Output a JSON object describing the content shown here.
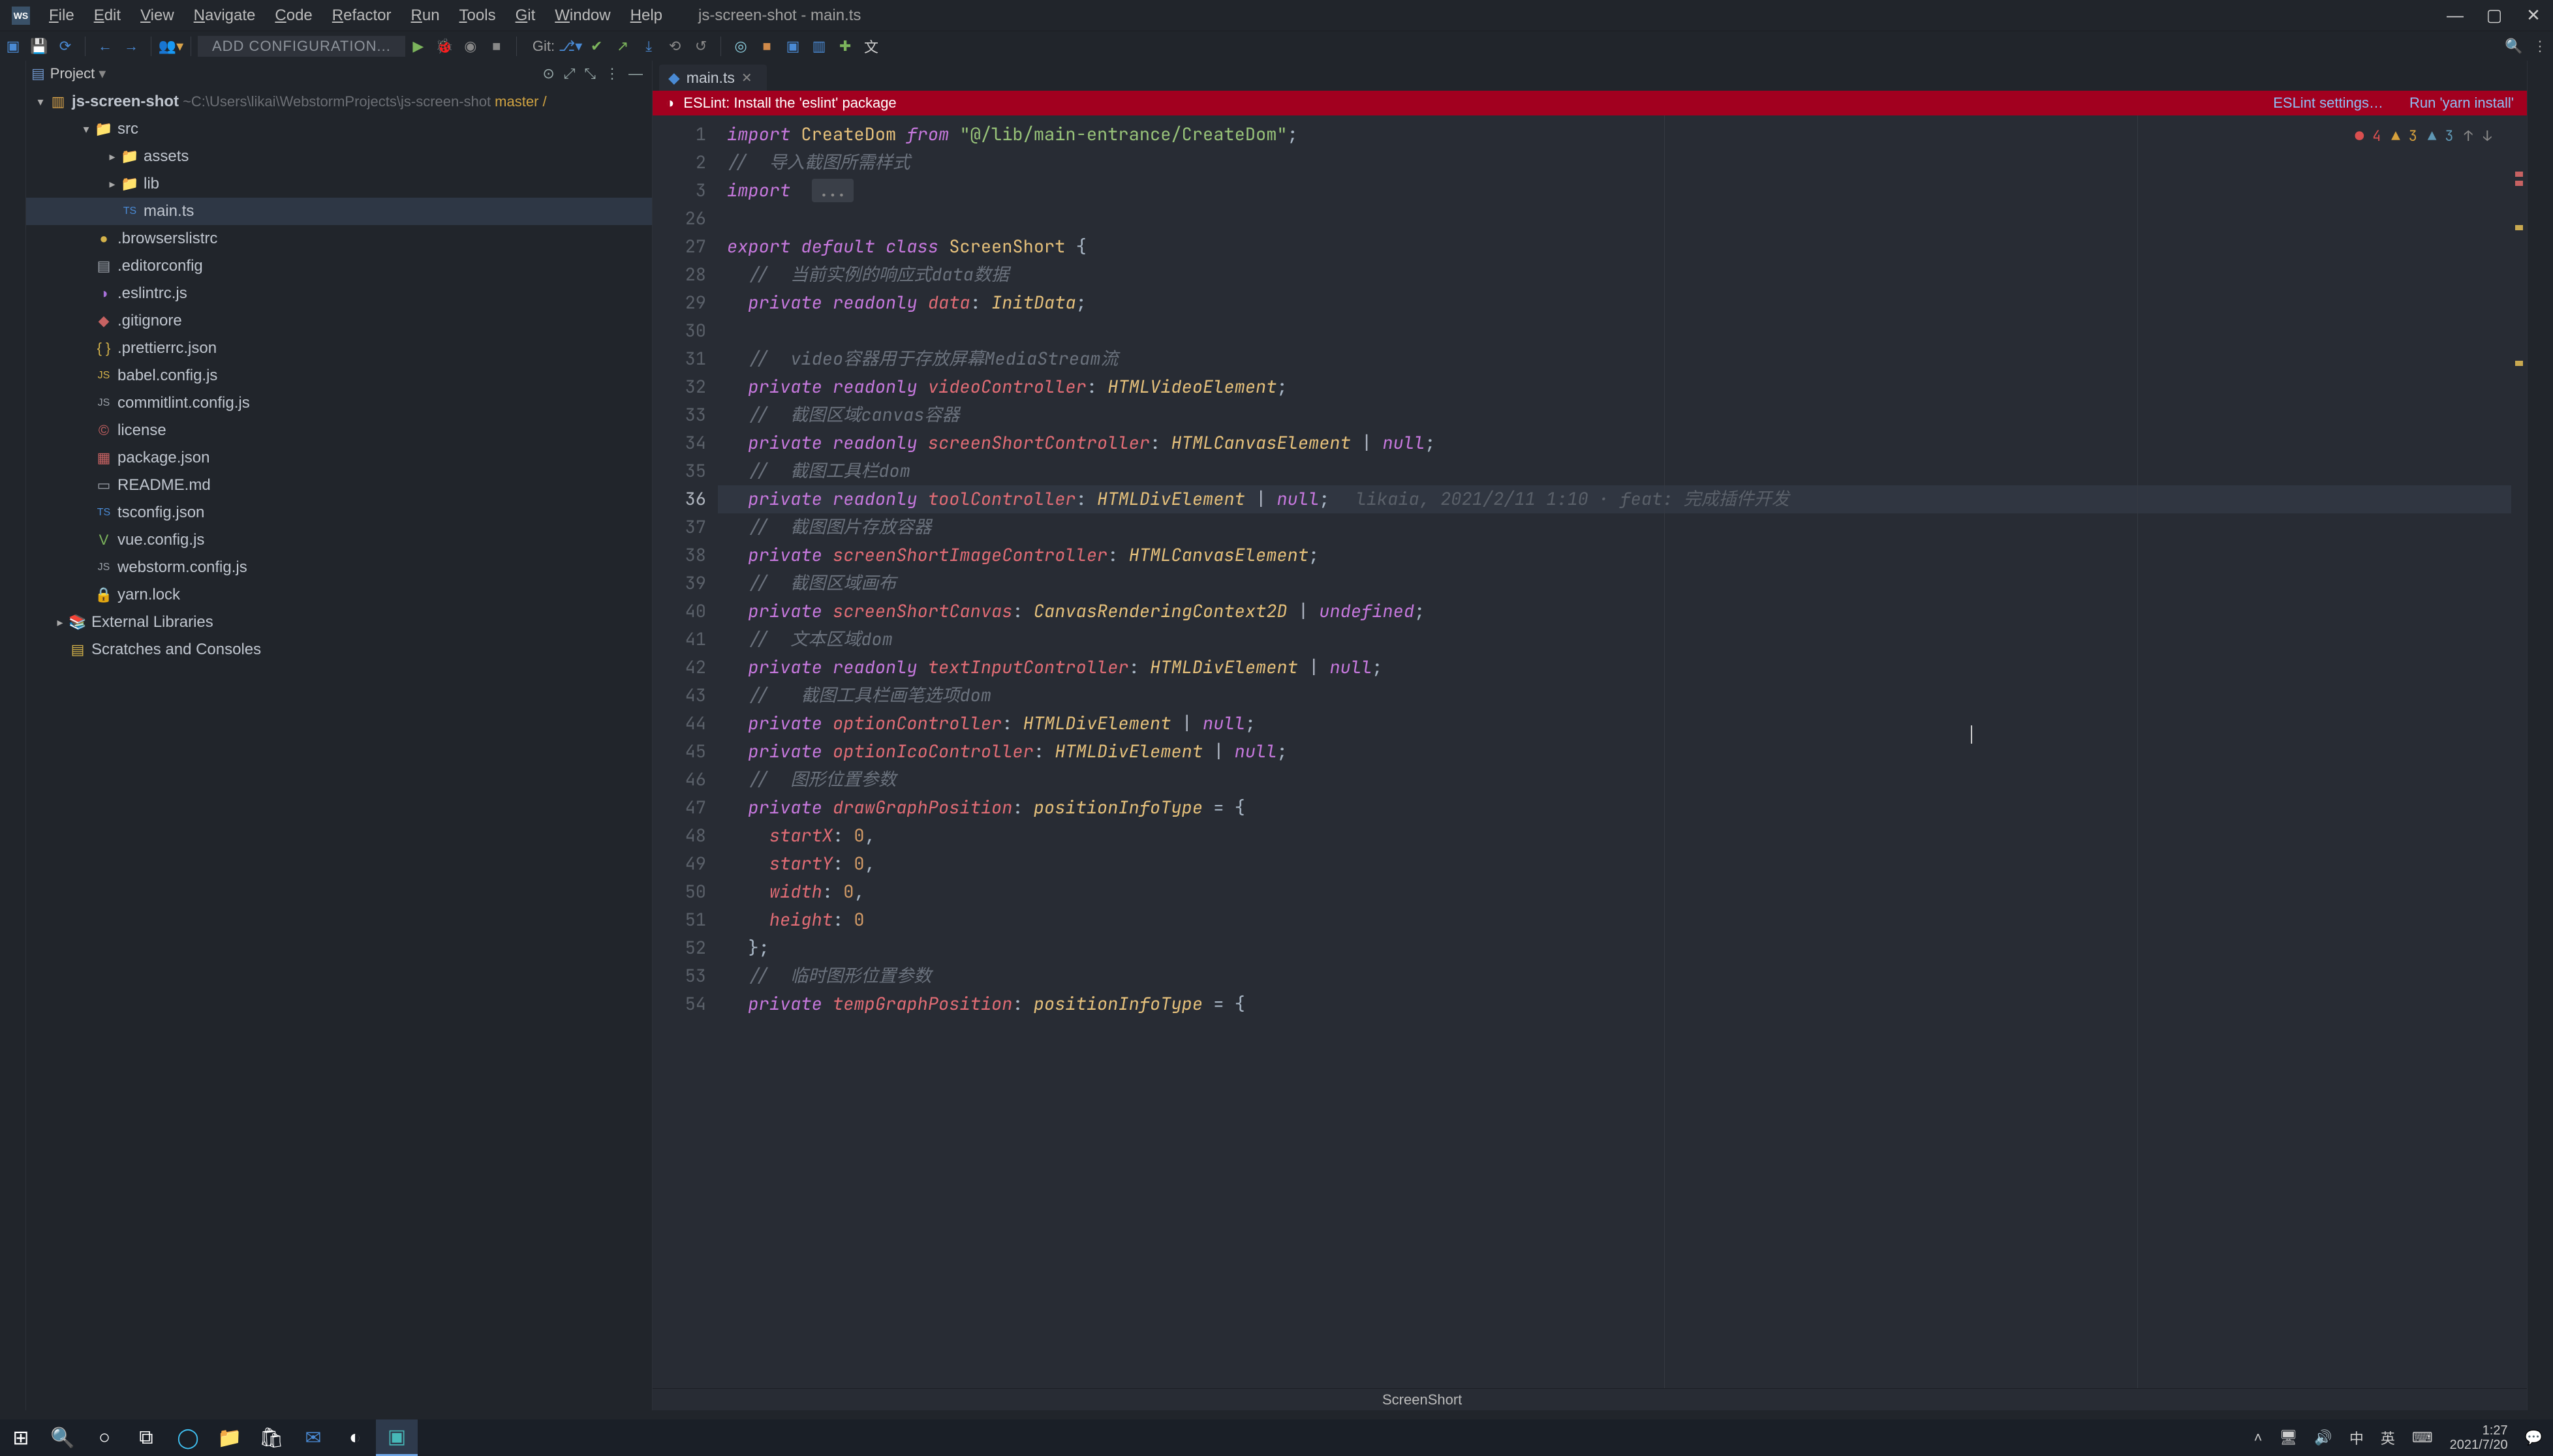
{
  "title_bar": {
    "app_logo": "WS",
    "menus": [
      "File",
      "Edit",
      "View",
      "Navigate",
      "Code",
      "Refactor",
      "Run",
      "Tools",
      "Git",
      "Window",
      "Help"
    ],
    "project_title": "js-screen-shot - main.ts"
  },
  "toolbar": {
    "add_config": "ADD CONFIGURATION...",
    "git_label": "Git:"
  },
  "project_panel": {
    "title": "Project",
    "root": {
      "name": "js-screen-shot",
      "path": "~C:\\Users\\likai\\WebstormProjects\\js-screen-shot",
      "branch": "master /"
    },
    "tree": [
      {
        "indent": 1,
        "caret": "▾",
        "icon": "folder",
        "color": "ic-folder",
        "label": "src"
      },
      {
        "indent": 2,
        "caret": "▸",
        "icon": "folder",
        "color": "ic-folder",
        "label": "assets"
      },
      {
        "indent": 2,
        "caret": "▸",
        "icon": "folder",
        "color": "ic-folder",
        "label": "lib"
      },
      {
        "indent": 2,
        "caret": "",
        "icon": "ts",
        "color": "ic-blue",
        "label": "main.ts",
        "selected": true
      },
      {
        "indent": 1,
        "caret": "",
        "icon": "dot",
        "color": "ic-yellow",
        "label": ".browserslistrc"
      },
      {
        "indent": 1,
        "caret": "",
        "icon": "cfg",
        "color": "ic-grey",
        "label": ".editorconfig"
      },
      {
        "indent": 1,
        "caret": "",
        "icon": "eslint",
        "color": "ic-purple",
        "label": ".eslintrc.js"
      },
      {
        "indent": 1,
        "caret": "",
        "icon": "git",
        "color": "ic-red",
        "label": ".gitignore"
      },
      {
        "indent": 1,
        "caret": "",
        "icon": "json",
        "color": "ic-yellow",
        "label": ".prettierrc.json"
      },
      {
        "indent": 1,
        "caret": "",
        "icon": "js",
        "color": "ic-yellow",
        "label": "babel.config.js"
      },
      {
        "indent": 1,
        "caret": "",
        "icon": "js",
        "color": "ic-grey",
        "label": "commitlint.config.js"
      },
      {
        "indent": 1,
        "caret": "",
        "icon": "lic",
        "color": "ic-red",
        "label": "license"
      },
      {
        "indent": 1,
        "caret": "",
        "icon": "npm",
        "color": "ic-red",
        "label": "package.json"
      },
      {
        "indent": 1,
        "caret": "",
        "icon": "md",
        "color": "ic-grey",
        "label": "README.md"
      },
      {
        "indent": 1,
        "caret": "",
        "icon": "ts",
        "color": "ic-blue",
        "label": "tsconfig.json"
      },
      {
        "indent": 1,
        "caret": "",
        "icon": "vue",
        "color": "ic-green",
        "label": "vue.config.js"
      },
      {
        "indent": 1,
        "caret": "",
        "icon": "js",
        "color": "ic-grey",
        "label": "webstorm.config.js"
      },
      {
        "indent": 1,
        "caret": "",
        "icon": "lock",
        "color": "ic-red",
        "label": "yarn.lock"
      },
      {
        "indent": 0,
        "caret": "▸",
        "icon": "lib",
        "color": "ic-yellow",
        "label": "External Libraries"
      },
      {
        "indent": 0,
        "caret": "",
        "icon": "scratch",
        "color": "ic-yellow",
        "label": "Scratches and Consoles"
      }
    ]
  },
  "editor": {
    "tab_label": "main.ts",
    "notice": {
      "text": "ESLint: Install the 'eslint' package",
      "link_settings": "ESLint settings…",
      "link_run": "Run 'yarn install'"
    },
    "inspections": {
      "errors": "4",
      "warnings": "3",
      "weak": "3"
    },
    "blame_text": "likaia, 2021/2/11 1:10 · feat: 完成插件开发",
    "breadcrumb": "ScreenShort",
    "lines": [
      {
        "n": "1",
        "html": "<span class='tok-kw'>import</span> <span class='tok-cls'>CreateDom</span> <span class='tok-kw'>from</span> <span class='tok-str'>\"@/lib/main-entrance/CreateDom\"</span>;"
      },
      {
        "n": "2",
        "html": "<span class='tok-cmt'>//  导入截图所需样式</span>"
      },
      {
        "n": "3",
        "html": "<span class='tok-kw'>import</span>  <span class='fold-dots'>...</span>"
      },
      {
        "n": "26",
        "html": ""
      },
      {
        "n": "27",
        "html": "<span class='tok-kw'>export</span> <span class='tok-kw'>default</span> <span class='tok-kw'>class</span> <span class='tok-cls'>ScreenShort</span> {"
      },
      {
        "n": "28",
        "html": "  <span class='tok-cmt'>//  当前实例的响应式data数据</span>"
      },
      {
        "n": "29",
        "html": "  <span class='tok-kw'>private</span> <span class='tok-kw'>readonly</span> <span class='tok-id'>data</span>: <span class='tok-type'>InitData</span>;"
      },
      {
        "n": "30",
        "html": ""
      },
      {
        "n": "31",
        "html": "  <span class='tok-cmt'>//  video容器用于存放屏幕MediaStream流</span>"
      },
      {
        "n": "32",
        "html": "  <span class='tok-kw'>private</span> <span class='tok-kw'>readonly</span> <span class='tok-id'>videoController</span>: <span class='tok-type'>HTMLVideoElement</span>;"
      },
      {
        "n": "33",
        "html": "  <span class='tok-cmt'>//  截图区域canvas容器</span>"
      },
      {
        "n": "34",
        "html": "  <span class='tok-kw'>private</span> <span class='tok-kw'>readonly</span> <span class='tok-id'>screenShortController</span>: <span class='tok-type'>HTMLCanvasElement</span> <span class='tok-op'>|</span> <span class='tok-kw2'>null</span>;"
      },
      {
        "n": "35",
        "html": "  <span class='tok-cmt'>//  截图工具栏dom</span>"
      },
      {
        "n": "36",
        "active": true,
        "html": "  <span class='tok-kw'>private</span> <span class='tok-kw'>readonly</span> <span class='tok-id'>toolController</span>: <span class='tok-type'>HTMLDivElement</span> <span class='tok-op'>|</span> <span class='tok-kw2'>null</span>;<span class='blame' data-bind='editor.blame_text'></span>"
      },
      {
        "n": "37",
        "html": "  <span class='tok-cmt'>//  截图图片存放容器</span>"
      },
      {
        "n": "38",
        "html": "  <span class='tok-kw'>private</span> <span class='tok-id'>screenShortImageController</span>: <span class='tok-type'>HTMLCanvasElement</span>;"
      },
      {
        "n": "39",
        "html": "  <span class='tok-cmt'>//  截图区域画布</span>"
      },
      {
        "n": "40",
        "html": "  <span class='tok-kw'>private</span> <span class='tok-id'>screenShortCanvas</span>: <span class='tok-type'>CanvasRenderingContext2D</span> <span class='tok-op'>|</span> <span class='tok-kw2'>undefined</span>;"
      },
      {
        "n": "41",
        "html": "  <span class='tok-cmt'>//  文本区域dom</span>"
      },
      {
        "n": "42",
        "html": "  <span class='tok-kw'>private</span> <span class='tok-kw'>readonly</span> <span class='tok-id'>textInputController</span>: <span class='tok-type'>HTMLDivElement</span> <span class='tok-op'>|</span> <span class='tok-kw2'>null</span>;"
      },
      {
        "n": "43",
        "html": "  <span class='tok-cmt'>//   截图工具栏画笔选项dom</span>"
      },
      {
        "n": "44",
        "html": "  <span class='tok-kw'>private</span> <span class='tok-id'>optionController</span>: <span class='tok-type'>HTMLDivElement</span> <span class='tok-op'>|</span> <span class='tok-kw2'>null</span>;"
      },
      {
        "n": "45",
        "html": "  <span class='tok-kw'>private</span> <span class='tok-id'>optionIcoController</span>: <span class='tok-type'>HTMLDivElement</span> <span class='tok-op'>|</span> <span class='tok-kw2'>null</span>;"
      },
      {
        "n": "46",
        "html": "  <span class='tok-cmt'>//  图形位置参数</span>"
      },
      {
        "n": "47",
        "html": "  <span class='tok-kw'>private</span> <span class='tok-id'>drawGraphPosition</span>: <span class='tok-type'>positionInfoType</span> = {"
      },
      {
        "n": "48",
        "html": "    <span class='tok-id'>startX</span>: <span class='tok-num'>0</span>,"
      },
      {
        "n": "49",
        "html": "    <span class='tok-id'>startY</span>: <span class='tok-num'>0</span>,"
      },
      {
        "n": "50",
        "html": "    <span class='tok-id'>width</span>: <span class='tok-num'>0</span>,"
      },
      {
        "n": "51",
        "html": "    <span class='tok-id'>height</span>: <span class='tok-num'>0</span>"
      },
      {
        "n": "52",
        "html": "  };"
      },
      {
        "n": "53",
        "html": "  <span class='tok-cmt'>//  临时图形位置参数</span>"
      },
      {
        "n": "54",
        "html": "  <span class='tok-kw'>private</span> <span class='tok-id'>tempGraphPosition</span>: <span class='tok-type'>positionInfoType</span> = {"
      }
    ]
  },
  "taskbar": {
    "tray": {
      "ime_lang": "中",
      "ime_mode": "英",
      "time": "1:27",
      "date": "2021/7/20"
    }
  }
}
